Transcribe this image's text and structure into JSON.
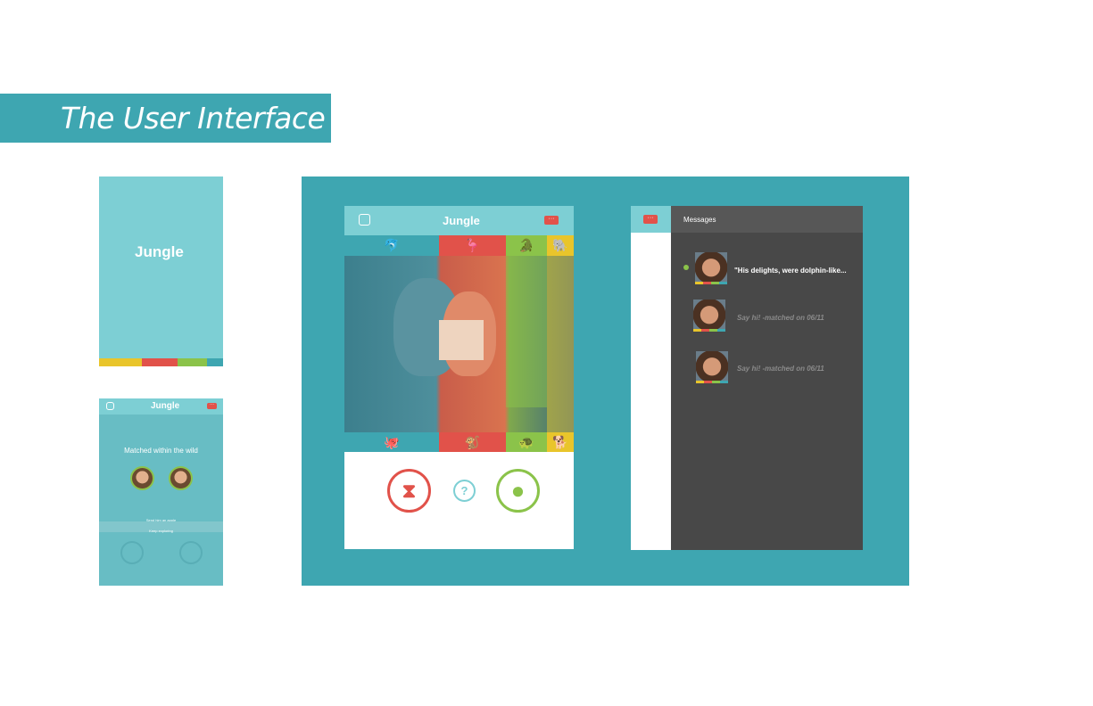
{
  "title": "The User Interface",
  "logo_text": "Jungle",
  "colors": {
    "teal": "#3ea6b1",
    "light_teal": "#7dcfd4",
    "red": "#e1524a",
    "green": "#8bc34a",
    "yellow": "#e9c52b",
    "dark": "#484848"
  },
  "splash": {
    "stripe_colors": [
      "#e9c52b",
      "#e1524a",
      "#8bc34a",
      "#3ea6b1"
    ]
  },
  "match": {
    "title": "Matched within the wild",
    "primary_action": "Send him an apple",
    "secondary_action": "Keep exploring"
  },
  "browse": {
    "top_icons": [
      "dolphin-icon",
      "flamingo-icon",
      "crocodile-icon",
      "elephant-icon"
    ],
    "bottom_icons": [
      "octopus-icon",
      "monkey-icon",
      "turtle-icon",
      "dog-icon"
    ],
    "actions": {
      "reject": "apple-core-icon",
      "unsure": "?",
      "like": "apple-icon"
    }
  },
  "messages": {
    "header": "Messages",
    "items": [
      {
        "text": "\"His delights, were dolphin-like...",
        "unread_dot": true
      },
      {
        "text": "Say hi! -matched on 06/11",
        "unread_dot": false
      },
      {
        "text": "Say hi! -matched on 06/11",
        "unread_dot": false
      }
    ]
  }
}
